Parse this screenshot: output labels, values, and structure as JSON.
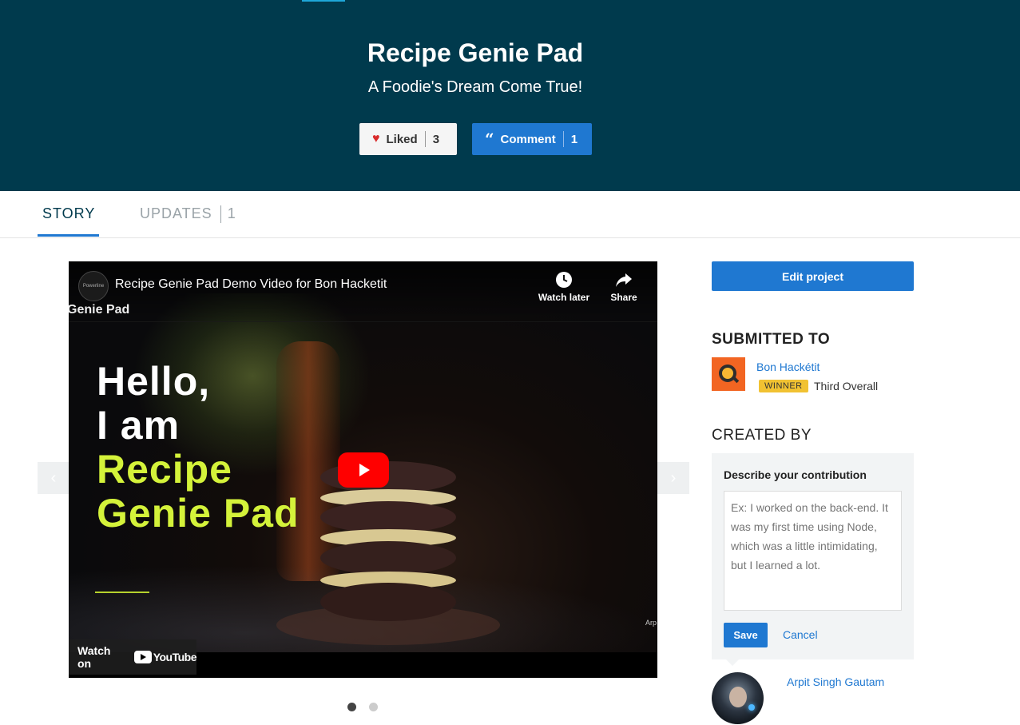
{
  "header": {
    "title": "Recipe Genie Pad",
    "tagline": "A Foodie's Dream Come True!",
    "like": {
      "label": "Liked",
      "count": "3"
    },
    "comment": {
      "label": "Comment",
      "count": "1"
    }
  },
  "tabs": {
    "story": "STORY",
    "updates": "UPDATES",
    "updates_count": "1"
  },
  "video": {
    "title": "Recipe Genie Pad Demo Video for Bon Hacketit",
    "overlay_text": "Genie Pad",
    "watch_later": "Watch later",
    "share": "Share",
    "hello_line1": "Hello,",
    "hello_line2": "I am",
    "hello_line3": "Recipe",
    "hello_line4": "Genie Pad",
    "watch_on": "Watch on",
    "youtube": "YouTube",
    "credit": "Arp",
    "channel": "Powerline"
  },
  "carousel": {
    "slides": 2,
    "active": 0,
    "left_arrow": "‹",
    "right_arrow": "›"
  },
  "sidebar": {
    "edit_project": "Edit project",
    "submitted_to": "SUBMITTED TO",
    "hackathon": "Bon Hackétit",
    "winner_badge": "WINNER",
    "winner_text": "Third Overall",
    "created_by": "CREATED BY",
    "contribution_label": "Describe your contribution",
    "contribution_placeholder": "Ex: I worked on the back-end. It was my first time using Node, which was a little intimidating, but I learned a lot.",
    "save": "Save",
    "cancel": "Cancel",
    "member_name": "Arpit Singh Gautam"
  },
  "colors": {
    "hero_bg": "#003a4d",
    "accent": "#1f78d1",
    "winner": "#f1c232",
    "heading_green": "#d4f23a"
  }
}
